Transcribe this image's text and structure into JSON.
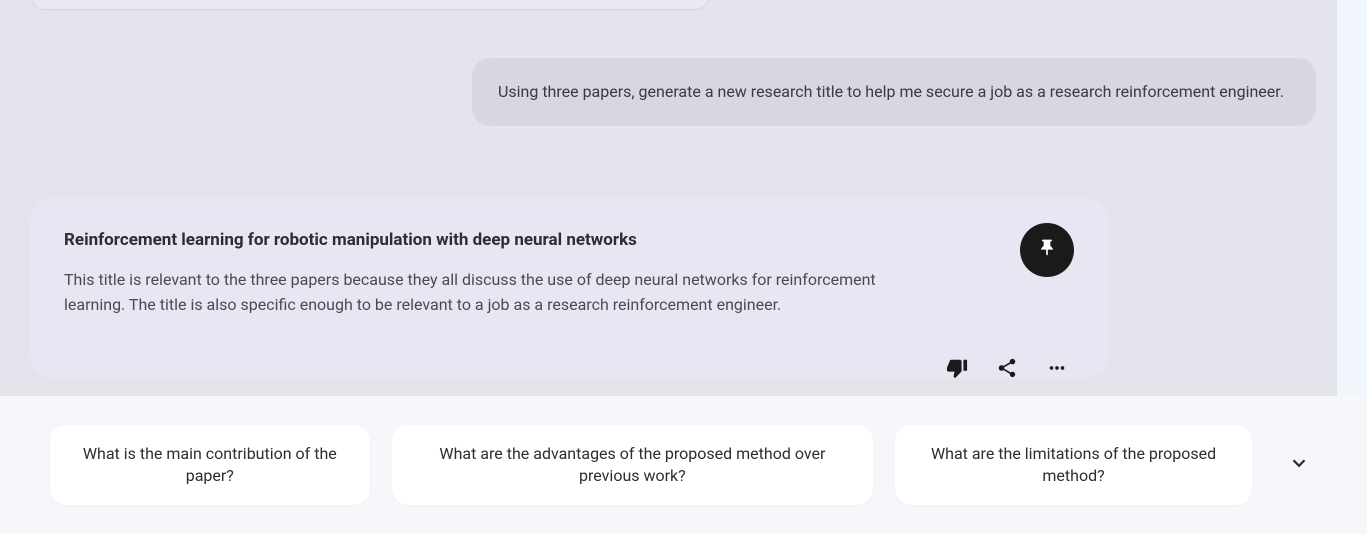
{
  "user_message": "Using three papers, generate a new research title to help me secure a job as a research reinforcement engineer.",
  "assistant": {
    "title": "Reinforcement learning for robotic manipulation with deep neural networks",
    "body": "This title is relevant to the three papers because they all discuss the use of deep neural networks for reinforcement learning. The title is also specific enough to be relevant to a job as a research reinforcement engineer."
  },
  "suggestions": [
    "What is the main contribution of the paper?",
    "What are the advantages of the proposed method over previous work?",
    "What are the limitations of the proposed method?"
  ]
}
